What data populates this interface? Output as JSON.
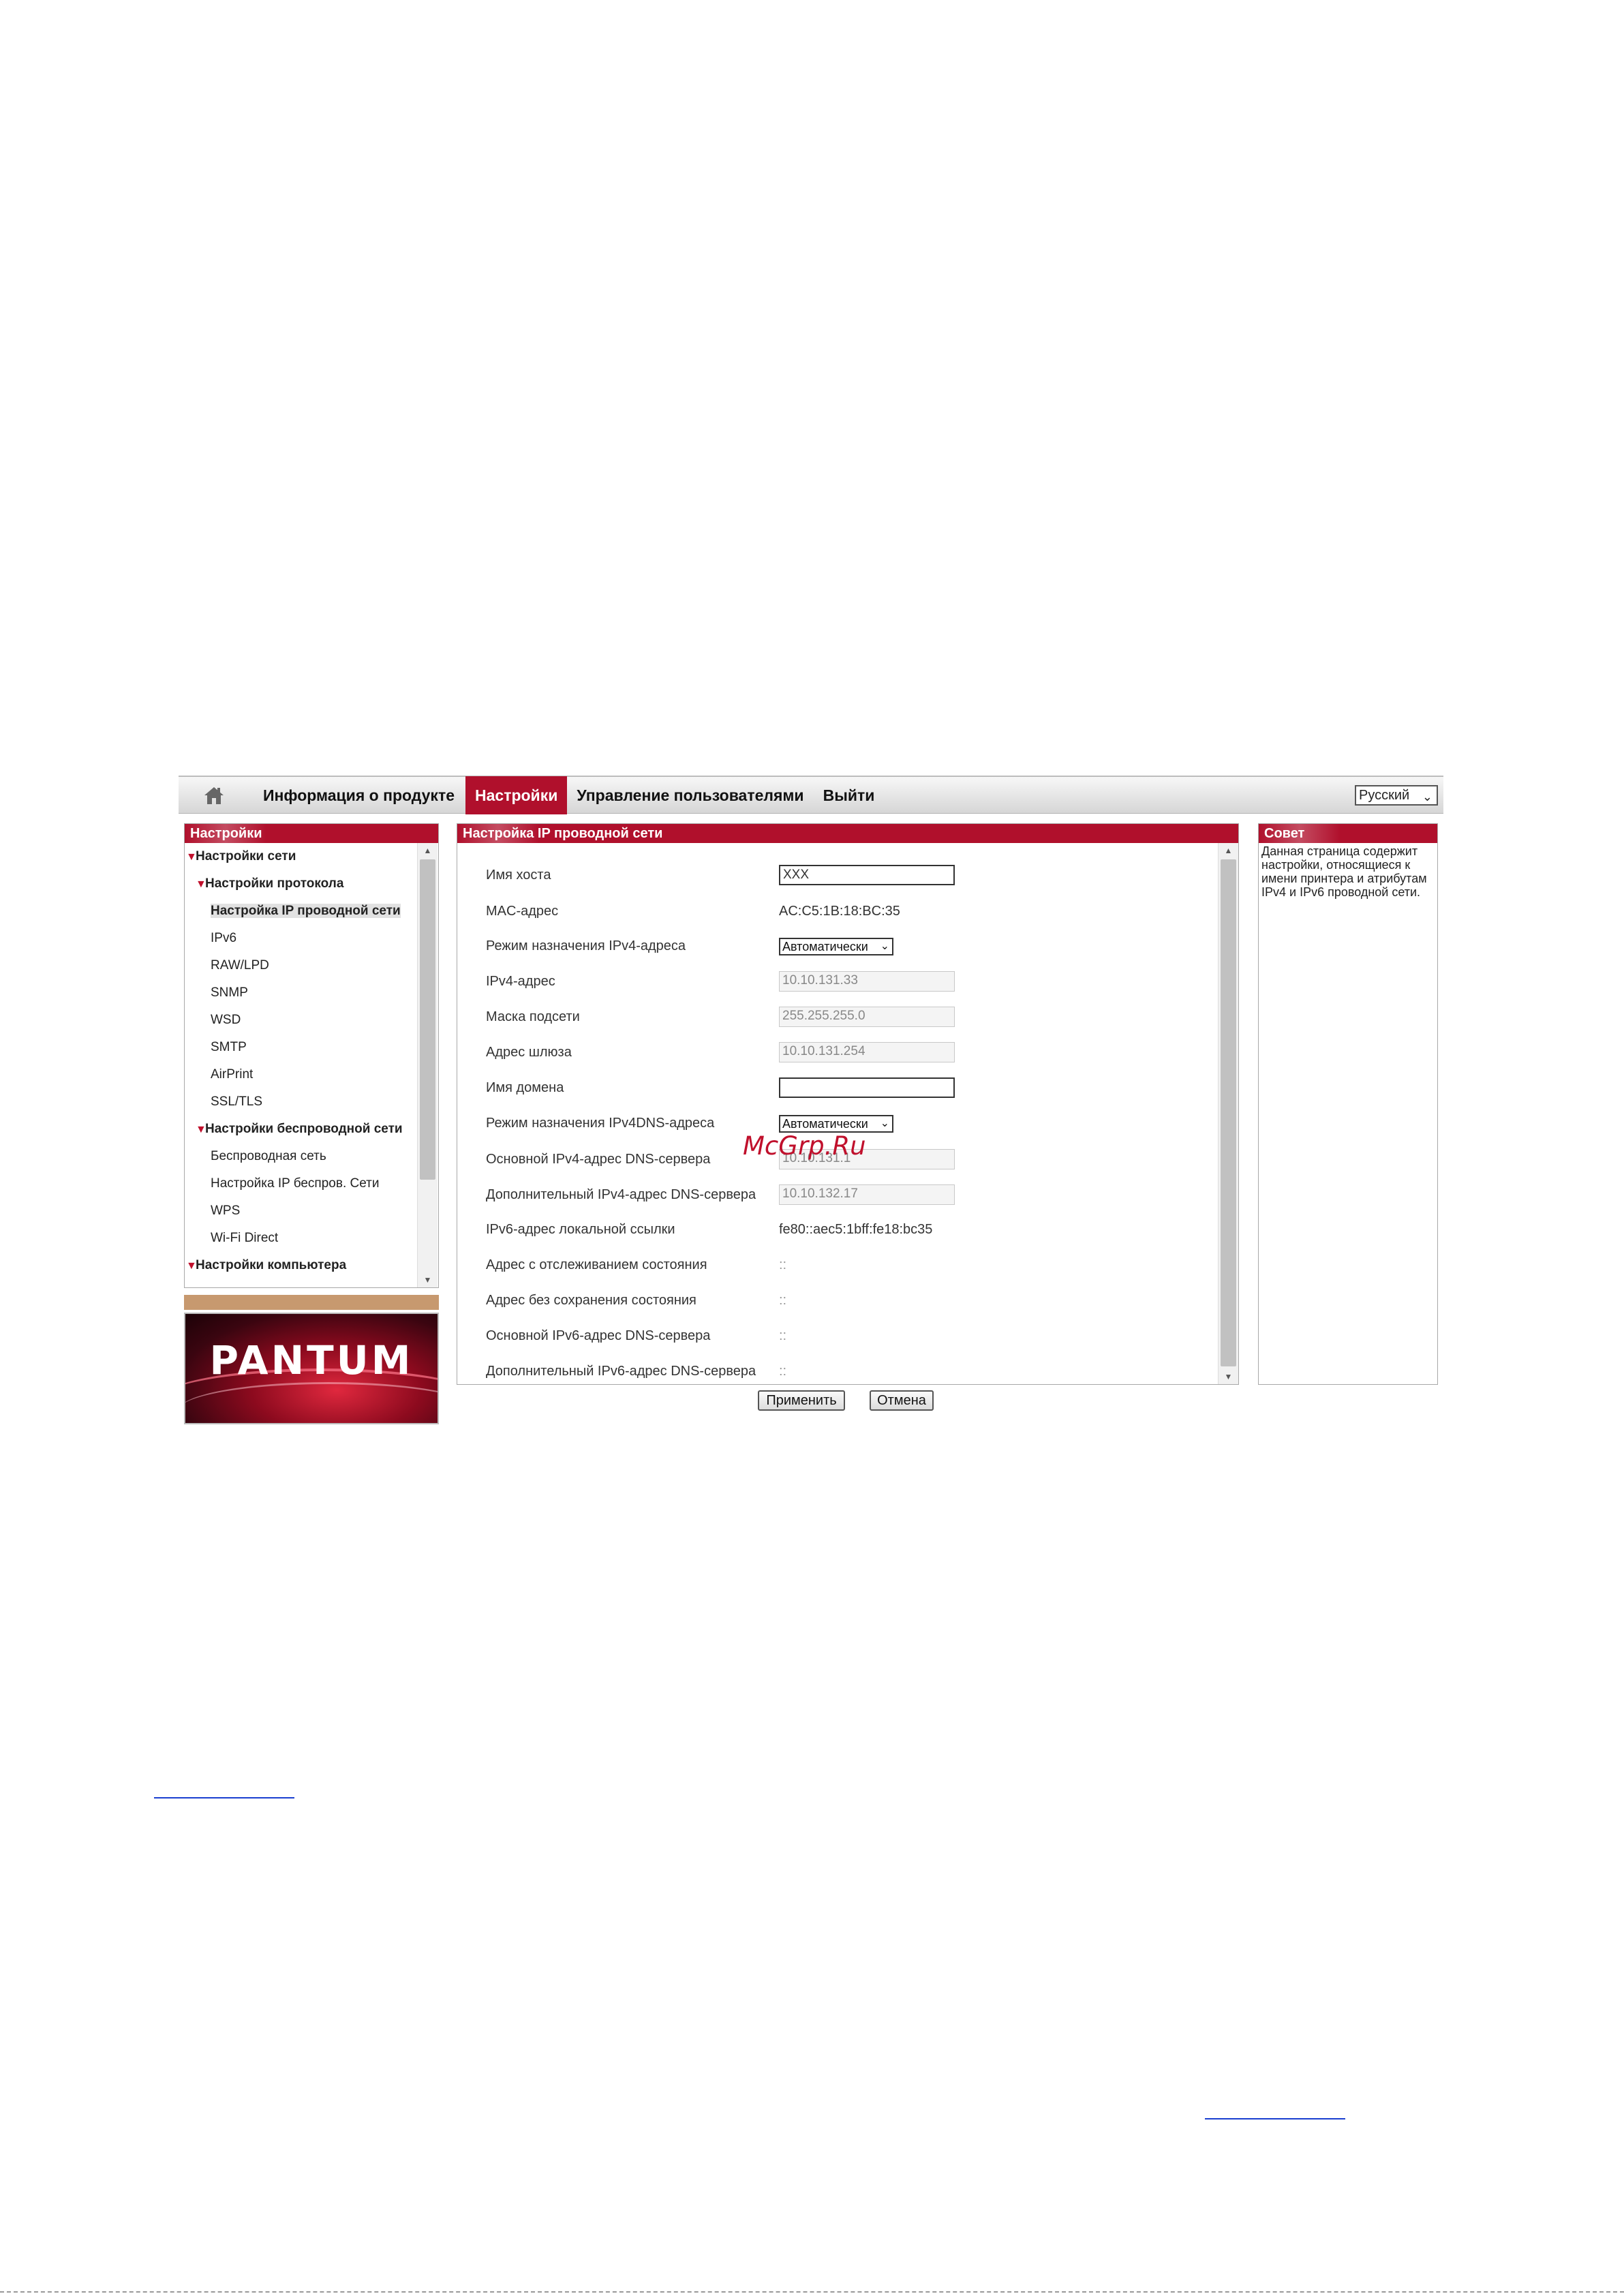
{
  "nav": {
    "items": [
      "Информация о продукте",
      "Настройки",
      "Управление пользователями",
      "Выйти"
    ],
    "active_index": 1,
    "language": "Русский"
  },
  "left_panel": {
    "title": "Настройки",
    "tree": [
      {
        "label": "Настройки сети",
        "level": 0,
        "expanded": true
      },
      {
        "label": "Настройки протокола",
        "level": 1,
        "expanded": true
      },
      {
        "label": "Настройка IP проводной сети",
        "level": 2,
        "selected": true
      },
      {
        "label": "IPv6",
        "level": 2
      },
      {
        "label": "RAW/LPD",
        "level": 2
      },
      {
        "label": "SNMP",
        "level": 2
      },
      {
        "label": "WSD",
        "level": 2
      },
      {
        "label": "SMTP",
        "level": 2
      },
      {
        "label": "AirPrint",
        "level": 2
      },
      {
        "label": "SSL/TLS",
        "level": 2
      },
      {
        "label": "Настройки беспроводной сети",
        "level": 1,
        "expanded": true
      },
      {
        "label": "Беспроводная сеть",
        "level": 2
      },
      {
        "label": "Настройка IP беспров. Сети",
        "level": 2
      },
      {
        "label": "WPS",
        "level": 2
      },
      {
        "label": "Wi-Fi Direct",
        "level": 2
      },
      {
        "label": "Настройки компьютера",
        "level": 0,
        "expanded": true
      }
    ],
    "logo_text": "PANTUM"
  },
  "main_panel": {
    "title": "Настройка IP проводной сети",
    "fields": [
      {
        "label": "Имя хоста",
        "type": "input",
        "value": "XXX"
      },
      {
        "label": "MAC-адрес",
        "type": "text",
        "value": "AC:C5:1B:18:BC:35"
      },
      {
        "label": "Режим назначения IPv4-адреса",
        "type": "select",
        "value": "Автоматически"
      },
      {
        "label": "IPv4-адрес",
        "type": "input-disabled",
        "value": "10.10.131.33"
      },
      {
        "label": "Маска подсети",
        "type": "input-disabled",
        "value": "255.255.255.0"
      },
      {
        "label": "Адрес шлюза",
        "type": "input-disabled",
        "value": "10.10.131.254"
      },
      {
        "label": "Имя домена",
        "type": "input",
        "value": ""
      },
      {
        "label": "Режим назначения IPv4DNS-адреса",
        "type": "select",
        "value": "Автоматически"
      },
      {
        "label": "Основной IPv4-адрес DNS-сервера",
        "type": "input-disabled",
        "value": "10.10.131.1"
      },
      {
        "label": "Дополнительный IPv4-адрес DNS-сервера",
        "type": "input-disabled",
        "value": "10.10.132.17"
      },
      {
        "label": "IPv6-адрес локальной ссылки",
        "type": "text",
        "value": "fe80::aec5:1bff:fe18:bc35"
      },
      {
        "label": "Адрес с отслеживанием состояния",
        "type": "text-muted",
        "value": "::"
      },
      {
        "label": "Адрес без сохранения состояния",
        "type": "text-muted",
        "value": "::"
      },
      {
        "label": "Основной IPv6-адрес DNS-сервера",
        "type": "text-muted",
        "value": "::"
      },
      {
        "label": "Дополнительный IPv6-адрес DNS-сервера",
        "type": "text-muted",
        "value": "::"
      }
    ],
    "watermark": "McGrp.Ru"
  },
  "buttons": {
    "apply": "Применить",
    "cancel": "Отмена"
  },
  "tip_panel": {
    "title": "Совет",
    "text": "Данная страница содержит настройки, относящиеся к имени принтера и атрибутам IPv4 и IPv6 проводной сети."
  },
  "colors": {
    "accent": "#b0102c",
    "divider": "#c7996f"
  },
  "icons": [
    "home-icon",
    "chevron-down-icon",
    "triangle-down-icon",
    "scroll-up-icon",
    "scroll-down-icon"
  ]
}
